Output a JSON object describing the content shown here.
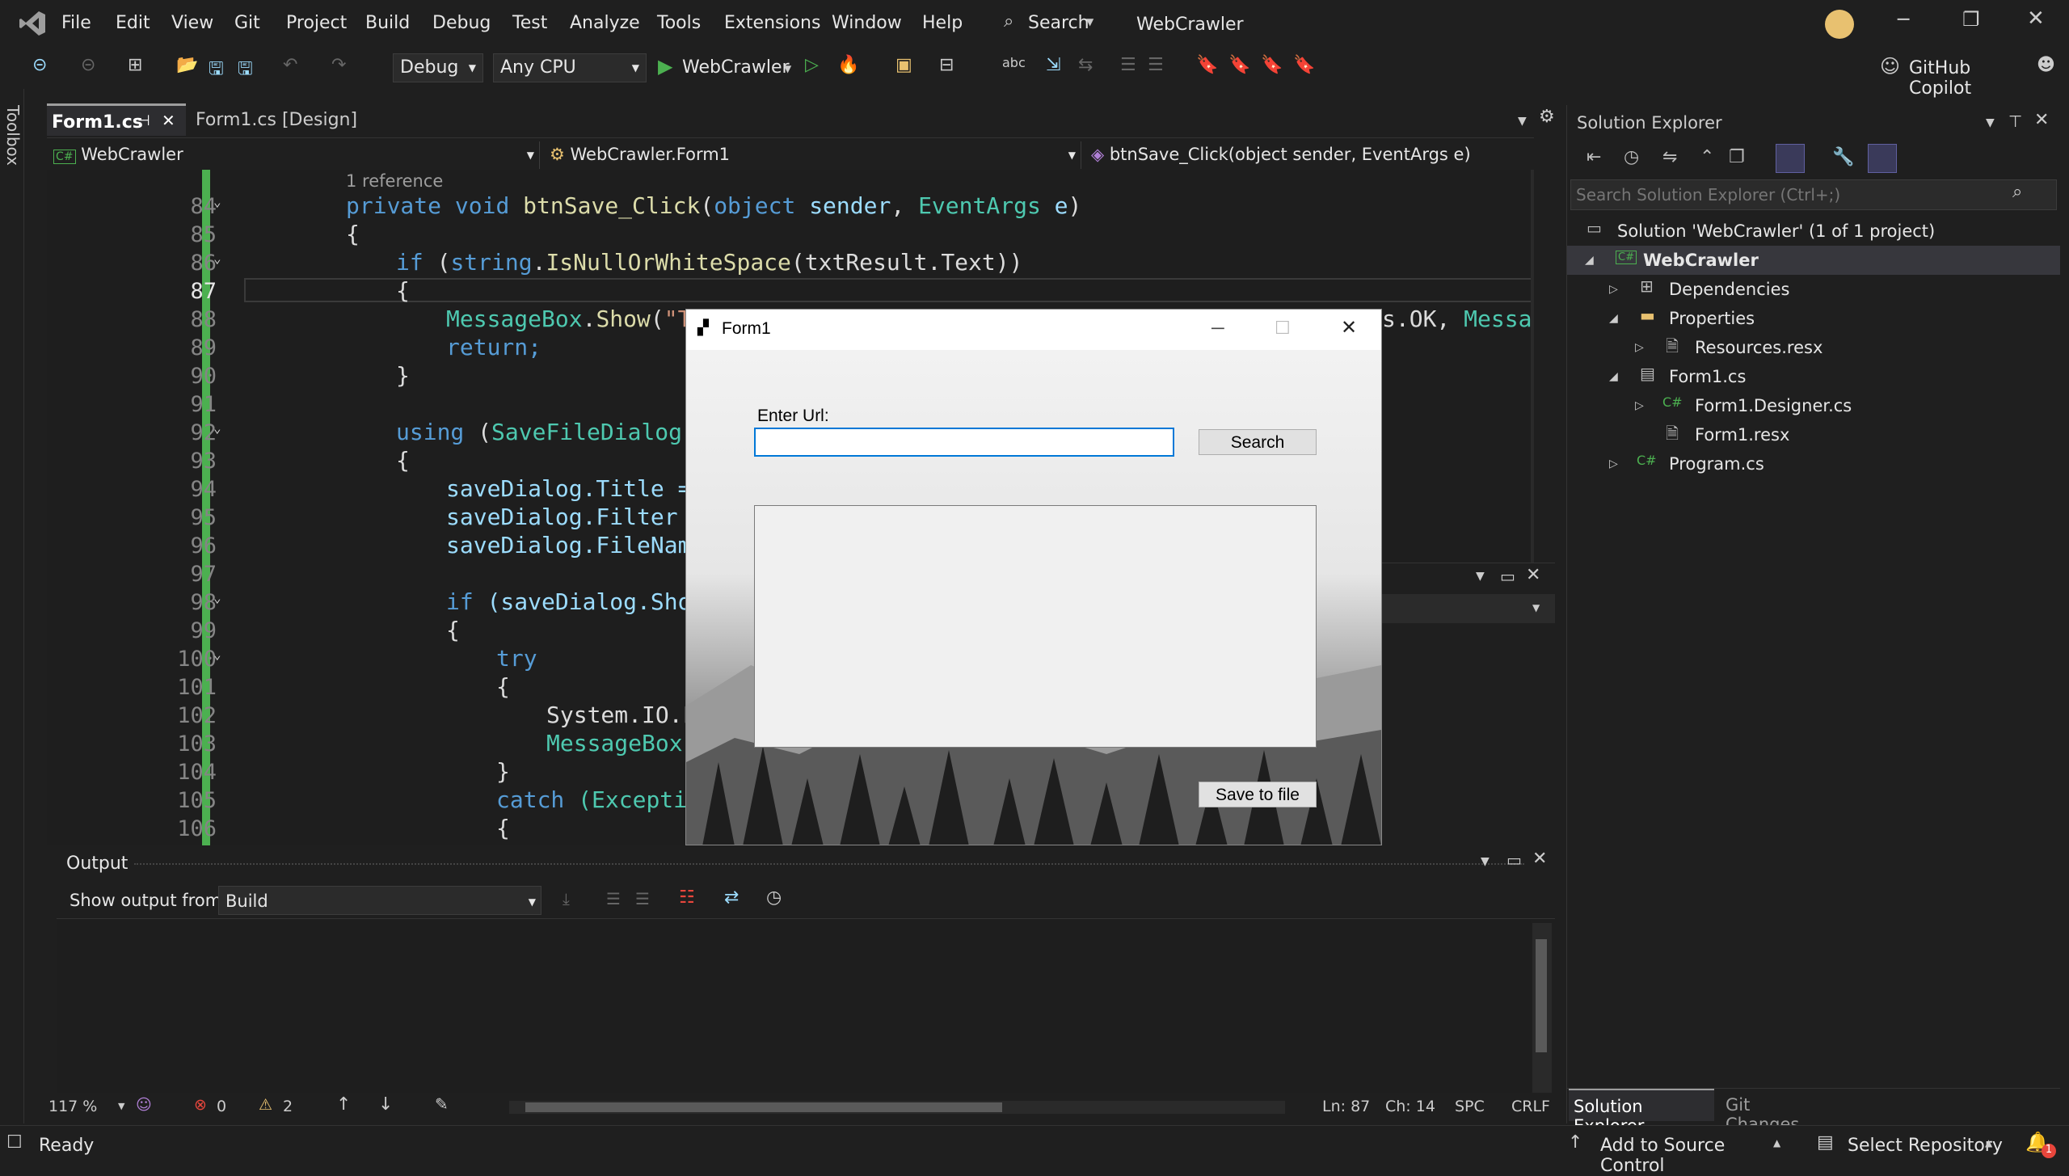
{
  "menu": [
    "File",
    "Edit",
    "View",
    "Git",
    "Project",
    "Build",
    "Debug",
    "Test",
    "Analyze",
    "Tools",
    "Extensions",
    "Window",
    "Help"
  ],
  "search_label": "Search",
  "app_title": "WebCrawler",
  "toolbar": {
    "config": "Debug",
    "platform": "Any CPU",
    "run_target": "WebCrawler",
    "copilot": "GitHub Copilot"
  },
  "toolbox_label": "Toolbox",
  "tabs": [
    {
      "label": "Form1.cs"
    },
    {
      "label": "Form1.cs [Design]"
    }
  ],
  "nav": {
    "project": "WebCrawler",
    "class": "WebCrawler.Form1",
    "member": "btnSave_Click(object sender, EventArgs e)"
  },
  "code": {
    "reference": "1 reference",
    "line_numbers": [
      "84",
      "85",
      "86",
      "87",
      "88",
      "89",
      "90",
      "91",
      "92",
      "93",
      "94",
      "95",
      "96",
      "97",
      "98",
      "99",
      "100",
      "101",
      "102",
      "103",
      "104",
      "105",
      "106"
    ],
    "l84_kw1": "private",
    "l84_kw2": "void",
    "l84_fn": "btnSave_Click",
    "l84_kw3": "object",
    "l84_p1": "sender",
    "l84_ty": "EventArgs",
    "l84_p2": "e",
    "brace_open": "{",
    "brace_close": "}",
    "l86_if": "if",
    "l86_kw": "string",
    "l86_fn": "IsNullOrWhiteSpace",
    "l86_rest": "(txtResult.Text))",
    "l88_ty": "MessageBox",
    "l88_fn": "Show",
    "l88_st": "\"Th",
    "l88_tail1": "s.OK, ",
    "l88_tail2": "Messag",
    "l89": "return;",
    "l92_kw": "using",
    "l92_ty": "SaveFileDialog",
    "l92_rest": "s",
    "l94": "saveDialog.Title =",
    "l95": "saveDialog.Filter =",
    "l96": "saveDialog.FileName",
    "l98_if": "if",
    "l98_rest": "(saveDialog.Show",
    "l100": "try",
    "l102": "System.IO.F",
    "l103": "MessageBox.",
    "l105_kw": "catch",
    "l105_ty": "(Exceptio"
  },
  "form1": {
    "title": "Form1",
    "label": "Enter Url:",
    "url_value": "",
    "search_button": "Search",
    "save_button": "Save to file"
  },
  "output": {
    "title": "Output",
    "show_from_label": "Show output from:",
    "source": "Build"
  },
  "editor_status": {
    "zoom": "117 %",
    "errors": "0",
    "warnings": "2",
    "line": "Ln: 87",
    "col": "Ch: 14",
    "spacing": "SPC",
    "eol": "CRLF"
  },
  "solution_explorer": {
    "title": "Solution Explorer",
    "search_placeholder": "Search Solution Explorer (Ctrl+;)",
    "solution": "Solution 'WebCrawler' (1 of 1 project)",
    "project": "WebCrawler",
    "items": [
      "Dependencies",
      "Properties",
      "Resources.resx",
      "Form1.cs",
      "Form1.Designer.cs",
      "Form1.resx",
      "Program.cs"
    ],
    "bottom_tabs": [
      "Solution Explorer",
      "Git Changes"
    ]
  },
  "status": {
    "ready": "Ready",
    "source_control": "Add to Source Control",
    "repository": "Select Repository",
    "notifications": "1"
  },
  "colors": {
    "accent": "#007acc",
    "keyword": "#569cd6",
    "type": "#4ec9b0",
    "method": "#dcdcaa",
    "string": "#ce9178",
    "change_bar": "#4cb050"
  }
}
